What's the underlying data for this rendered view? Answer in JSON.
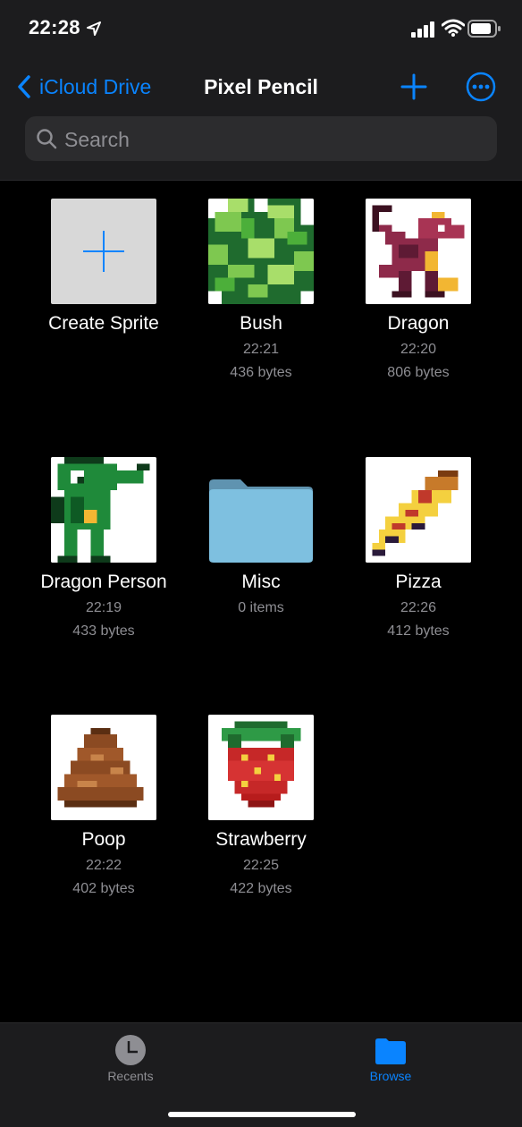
{
  "status_bar": {
    "time": "22:28"
  },
  "nav": {
    "back_label": "iCloud Drive",
    "title": "Pixel Pencil"
  },
  "search": {
    "placeholder": "Search",
    "value": ""
  },
  "items": [
    {
      "name": "Create Sprite",
      "time": "",
      "size": "",
      "icon": "plus-icon"
    },
    {
      "name": "Bush",
      "time": "22:21",
      "size": "436 bytes",
      "icon": "bush-sprite"
    },
    {
      "name": "Dragon",
      "time": "22:20",
      "size": "806 bytes",
      "icon": "dragon-sprite"
    },
    {
      "name": "Dragon Person",
      "time": "22:19",
      "size": "433 bytes",
      "icon": "dragon-person-sprite"
    },
    {
      "name": "Misc",
      "time": "0 items",
      "size": "",
      "icon": "folder-icon"
    },
    {
      "name": "Pizza",
      "time": "22:26",
      "size": "412 bytes",
      "icon": "pizza-sprite"
    },
    {
      "name": "Poop",
      "time": "22:22",
      "size": "402 bytes",
      "icon": "poop-sprite"
    },
    {
      "name": "Strawberry",
      "time": "22:25",
      "size": "422 bytes",
      "icon": "strawberry-sprite"
    }
  ],
  "tabbar": {
    "recents_label": "Recents",
    "browse_label": "Browse",
    "active": "Browse"
  },
  "colors": {
    "accent": "#0a84ff",
    "background": "#000000",
    "bar": "#1c1c1e",
    "secondary_text": "#8e8e93"
  }
}
